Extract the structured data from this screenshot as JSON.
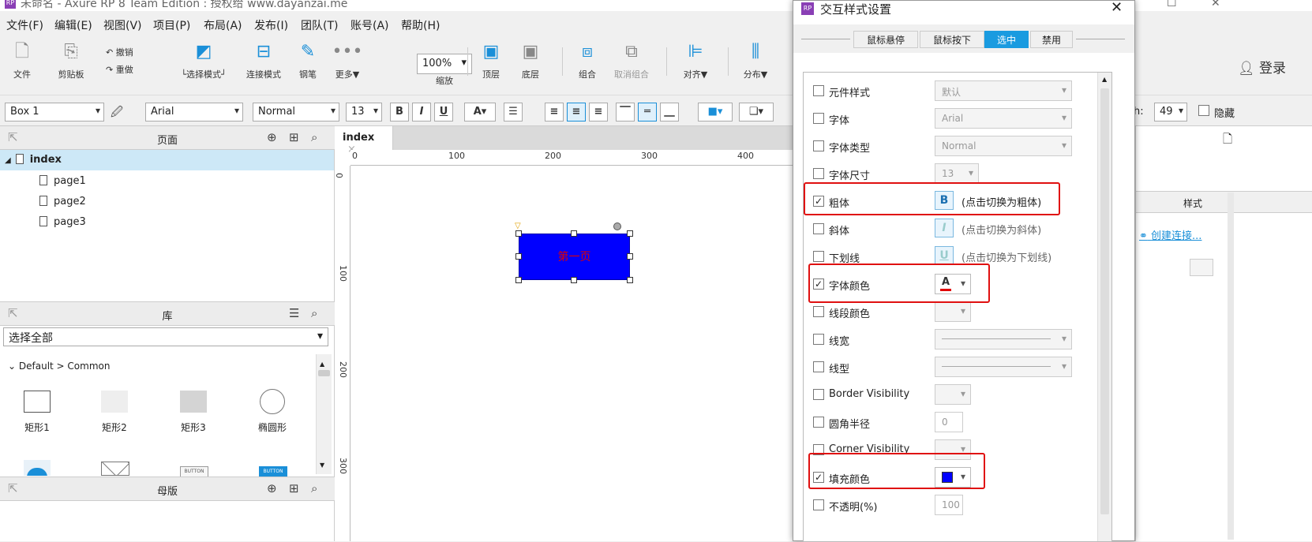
{
  "app": {
    "title": "未命名 - Axure RP 8 Team Edition : 授权给 www.dayanzai.me",
    "logo": "RP"
  },
  "menu": [
    "文件(F)",
    "编辑(E)",
    "视图(V)",
    "项目(P)",
    "布局(A)",
    "发布(I)",
    "团队(T)",
    "账号(A)",
    "帮助(H)"
  ],
  "toolbar": {
    "file": "文件",
    "clipboard": "剪贴板",
    "undo": "撤销",
    "redo": "重做",
    "select_mode": "└选择模式┘",
    "connect_mode": "连接模式",
    "pen": "钢笔",
    "more": "更多▼",
    "zoom_value": "100%",
    "zoom_label": "缩放",
    "top_layer": "顶层",
    "bottom_layer": "底层",
    "group": "组合",
    "ungroup": "取消组合",
    "align": "对齐▼",
    "distribute": "分布▼",
    "login": "登录"
  },
  "format": {
    "widget_name": "Box 1",
    "font": "Arial",
    "font_type": "Normal",
    "font_size": "13",
    "h_label": "h:",
    "h_value": "49",
    "hide_label": "隐藏"
  },
  "pages_panel": {
    "title": "页面",
    "root": "index",
    "pages": [
      "page1",
      "page2",
      "page3"
    ]
  },
  "library_panel": {
    "title": "库",
    "filter": "选择全部",
    "group": "Default > Common",
    "items": [
      "矩形1",
      "矩形2",
      "矩形3",
      "椭圆形"
    ],
    "button_labels": [
      "BUTTON",
      "BUTTON"
    ]
  },
  "masters_panel": {
    "title": "母版"
  },
  "canvas": {
    "tab": "index",
    "ruler_h": [
      "0",
      "100",
      "200",
      "300",
      "400"
    ],
    "ruler_v": [
      "0",
      "100",
      "200",
      "300"
    ],
    "box_text": "第一页",
    "box_fill": "#0000ff",
    "box_text_color": "#e00000"
  },
  "right_panel": {
    "style_tab": "样式",
    "create_link": "创建连接..."
  },
  "dialog": {
    "title": "交互样式设置",
    "tabs": [
      "鼠标悬停",
      "鼠标按下",
      "选中",
      "禁用"
    ],
    "active_tab": "选中",
    "rows": [
      {
        "label": "元件样式",
        "checked": false,
        "value": "默认"
      },
      {
        "label": "字体",
        "checked": false,
        "value": "Arial"
      },
      {
        "label": "字体类型",
        "checked": false,
        "value": "Normal"
      },
      {
        "label": "字体尺寸",
        "checked": false,
        "value": "13"
      },
      {
        "label": "粗体",
        "checked": true,
        "hint": "(点击切换为粗体)"
      },
      {
        "label": "斜体",
        "checked": false,
        "hint": "(点击切换为斜体)"
      },
      {
        "label": "下划线",
        "checked": false,
        "hint": "(点击切换为下划线)"
      },
      {
        "label": "字体颜色",
        "checked": true
      },
      {
        "label": "线段颜色",
        "checked": false
      },
      {
        "label": "线宽",
        "checked": false
      },
      {
        "label": "线型",
        "checked": false
      },
      {
        "label": "Border Visibility",
        "checked": false
      },
      {
        "label": "圆角半径",
        "checked": false,
        "value": "0"
      },
      {
        "label": "Corner Visibility",
        "checked": false
      },
      {
        "label": "填充颜色",
        "checked": true
      },
      {
        "label": "不透明(%)",
        "checked": false,
        "value": "100"
      }
    ],
    "accent": "#1a9be0",
    "highlight": "#e01010",
    "fill_color": "#0000ff",
    "font_color_bar": "#e00000",
    "icons": [
      "bold-icon",
      "italic-icon",
      "underline-icon",
      "font-color-icon",
      "fill-color-icon",
      "close-icon"
    ]
  }
}
